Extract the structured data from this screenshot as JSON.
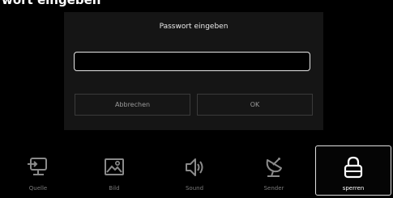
{
  "page": {
    "partial_title": "wort eingeben"
  },
  "dialog": {
    "title": "Passwort eingeben",
    "password_value": "",
    "cancel_label": "Abbrechen",
    "ok_label": "OK"
  },
  "toolbar": {
    "items": [
      {
        "label": "Quelle",
        "icon": "source-input-icon",
        "active": false
      },
      {
        "label": "Bild",
        "icon": "picture-icon",
        "active": false
      },
      {
        "label": "Sound",
        "icon": "speaker-icon",
        "active": false
      },
      {
        "label": "Sender",
        "icon": "satellite-dish-icon",
        "active": false
      },
      {
        "label": "sperren",
        "icon": "lock-icon",
        "active": true
      }
    ]
  },
  "colors": {
    "background": "#000000",
    "dialog_bg": "#151515",
    "inactive_text": "#7a7a7a",
    "active_text": "#ffffff",
    "border": "#e0e0e0"
  }
}
